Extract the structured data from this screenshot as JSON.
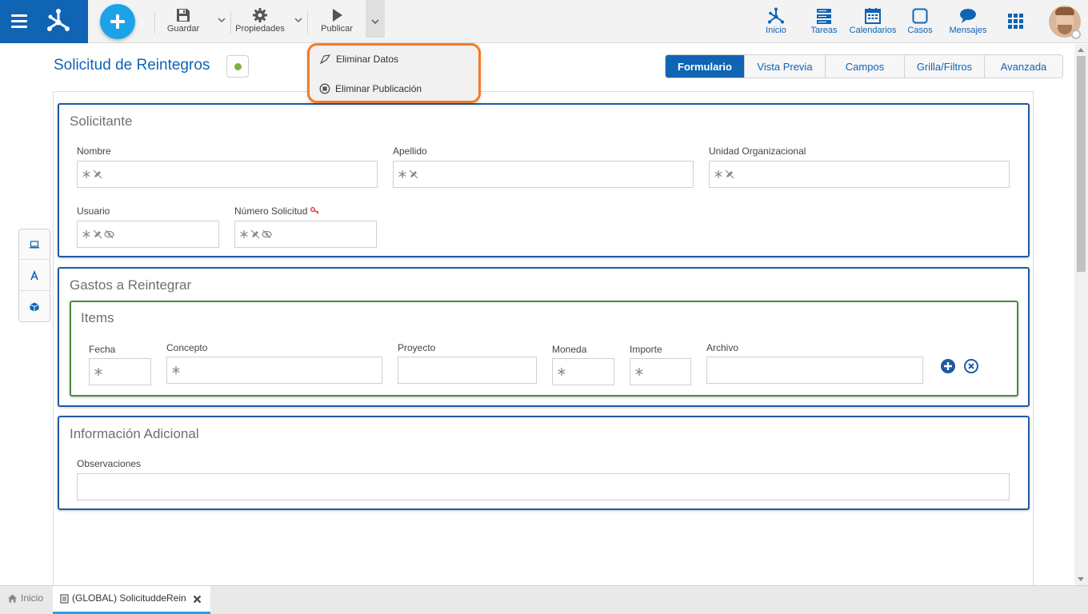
{
  "toolbar": {
    "save_label": "Guardar",
    "properties_label": "Propiedades",
    "publish_label": "Publicar"
  },
  "publish_menu": {
    "items": [
      {
        "label": "Eliminar Datos",
        "icon": "eraser-icon"
      },
      {
        "label": "Eliminar Publicación",
        "icon": "stop-circle-icon"
      }
    ]
  },
  "nav": {
    "items": [
      {
        "label": "Inicio",
        "icon": "network-icon"
      },
      {
        "label": "Tareas",
        "icon": "tasks-icon"
      },
      {
        "label": "Calendarios",
        "icon": "calendar-icon"
      },
      {
        "label": "Casos",
        "icon": "square-icon"
      },
      {
        "label": "Mensajes",
        "icon": "chat-bubble-icon"
      }
    ]
  },
  "page": {
    "title": "Solicitud de Reintegros",
    "status_color": "#7cb342"
  },
  "tabs": [
    "Formulario",
    "Vista Previa",
    "Campos",
    "Grilla/Filtros",
    "Avanzada"
  ],
  "active_tab": "Formulario",
  "form": {
    "solicitante": {
      "title": "Solicitante",
      "fields": [
        "Nombre",
        "Apellido",
        "Unidad Organizacional",
        "Usuario",
        "Número Solicitud"
      ]
    },
    "gastos": {
      "title": "Gastos a Reintegrar",
      "grid_title": "Items",
      "columns": [
        "Fecha",
        "Concepto",
        "Proyecto",
        "Moneda",
        "Importe",
        "Archivo"
      ]
    },
    "adicional": {
      "title": "Información Adicional",
      "fields": [
        "Observaciones"
      ]
    }
  },
  "bottom_tabs": {
    "home_label": "Inicio",
    "open_tab_label": "(GLOBAL) SolicituddeRein"
  },
  "colors": {
    "brand": "#0f64b4",
    "accent": "#1ba3e8",
    "highlight": "#f47b20",
    "grid_border": "#4c8c3c"
  }
}
